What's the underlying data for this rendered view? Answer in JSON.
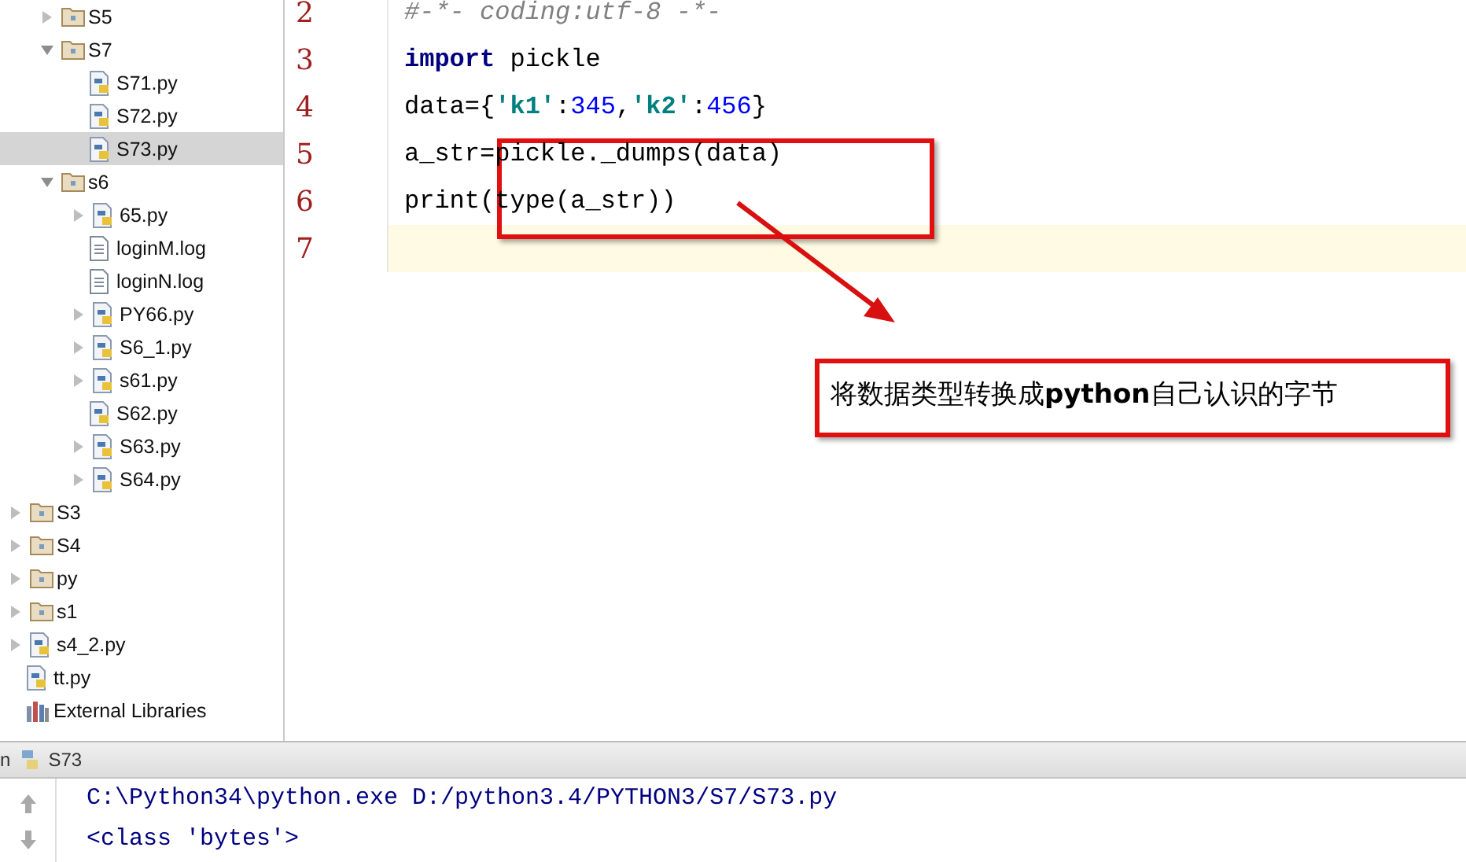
{
  "project_tree": {
    "nested_items": [
      {
        "label": "S5",
        "kind": "folder",
        "expanded": false
      },
      {
        "label": "S7",
        "kind": "folder",
        "expanded": true,
        "children": [
          {
            "label": "S71.py",
            "kind": "python",
            "selected": false
          },
          {
            "label": "S72.py",
            "kind": "python",
            "selected": false
          },
          {
            "label": "S73.py",
            "kind": "python",
            "selected": true
          }
        ]
      },
      {
        "label": "s6",
        "kind": "folder",
        "expanded": true,
        "children": [
          {
            "label": "65.py",
            "kind": "python",
            "expanded": false
          },
          {
            "label": "loginM.log",
            "kind": "log"
          },
          {
            "label": "loginN.log",
            "kind": "log"
          },
          {
            "label": "PY66.py",
            "kind": "python",
            "expanded": false
          },
          {
            "label": "S6_1.py",
            "kind": "python",
            "expanded": false
          },
          {
            "label": "s61.py",
            "kind": "python",
            "expanded": false
          },
          {
            "label": "S62.py",
            "kind": "python"
          },
          {
            "label": "S63.py",
            "kind": "python",
            "expanded": false
          },
          {
            "label": "S64.py",
            "kind": "python",
            "expanded": false
          }
        ]
      }
    ],
    "items": [
      {
        "label": "S3",
        "kind": "folder",
        "expanded": false
      },
      {
        "label": "S4",
        "kind": "folder",
        "expanded": false
      },
      {
        "label": "py",
        "kind": "folder",
        "expanded": false
      },
      {
        "label": "s1",
        "kind": "folder",
        "expanded": false
      },
      {
        "label": "s4_2.py",
        "kind": "python",
        "expanded": false
      },
      {
        "label": "tt.py",
        "kind": "python"
      },
      {
        "label": "External Libraries",
        "kind": "libraries"
      }
    ]
  },
  "editor": {
    "lines": [
      {
        "number": "2",
        "current": false,
        "tokens": [
          {
            "kind": "comment",
            "text": "#-*- coding:utf-8 -*-"
          }
        ]
      },
      {
        "number": "3",
        "current": false,
        "tokens": [
          {
            "kind": "keyword",
            "text": "import"
          },
          {
            "kind": "plain",
            "text": " pickle"
          }
        ]
      },
      {
        "number": "4",
        "current": false,
        "tokens": [
          {
            "kind": "plain",
            "text": "data={"
          },
          {
            "kind": "string",
            "text": "'k1'"
          },
          {
            "kind": "plain",
            "text": ":"
          },
          {
            "kind": "number",
            "text": "345"
          },
          {
            "kind": "plain",
            "text": ","
          },
          {
            "kind": "string",
            "text": "'k2'"
          },
          {
            "kind": "plain",
            "text": ":"
          },
          {
            "kind": "number",
            "text": "456"
          },
          {
            "kind": "plain",
            "text": "}"
          }
        ]
      },
      {
        "number": "5",
        "current": false,
        "tokens": [
          {
            "kind": "plain",
            "text": "a_str=pickle._dumps(data)"
          }
        ]
      },
      {
        "number": "6",
        "current": false,
        "tokens": [
          {
            "kind": "plain",
            "text": "print(type(a_str))"
          }
        ]
      },
      {
        "number": "7",
        "current": true
      }
    ]
  },
  "annotation": {
    "callout": "将数据类型转换成**python**自己认识的字节"
  },
  "run_panel": {
    "tab_cut": "n",
    "tab_label": "S73",
    "output": [
      "C:\\Python34\\python.exe D:/python3.4/PYTHON3/S7/S73.py",
      "<class 'bytes'>"
    ]
  }
}
